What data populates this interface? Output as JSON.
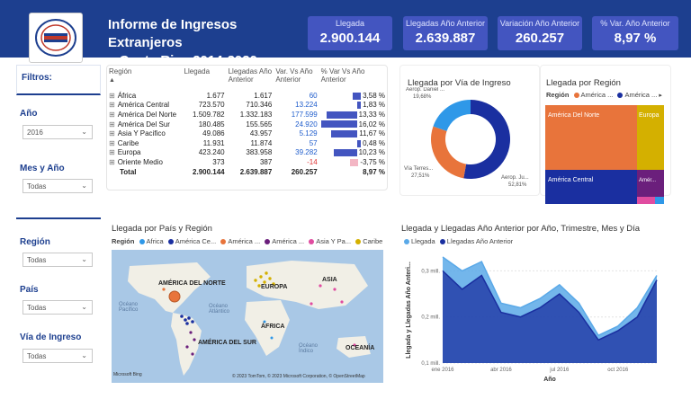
{
  "header": {
    "title_line1": "Informe de Ingresos Extranjeros",
    "title_line2": "a Costa Rica 2014-2020",
    "bg_color": "#1d3f8f"
  },
  "kpis": [
    {
      "label": "Llegada",
      "value": "2.900.144"
    },
    {
      "label": "Llegadas Año Anterior",
      "value": "2.639.887"
    },
    {
      "label": "Variación Año Anterior",
      "value": "260.257"
    },
    {
      "label": "% Var. Año Anterior",
      "value": "8,97 %"
    }
  ],
  "filters": {
    "title": "Filtros:",
    "year": {
      "label": "Año",
      "value": "2016"
    },
    "month": {
      "label": "Mes y Año",
      "value": "Todas"
    },
    "region": {
      "label": "Región",
      "value": "Todas"
    },
    "country": {
      "label": "País",
      "value": "Todas"
    },
    "route": {
      "label": "Vía de Ingreso",
      "value": "Todas"
    }
  },
  "table": {
    "headers": [
      "Región",
      "Llegada",
      "Llegadas Año Anterior",
      "Var. Vs Año Anterior",
      "% Var Vs Año Anterior"
    ],
    "rows": [
      {
        "region": "África",
        "llegada": "1.677",
        "anterior": "1.617",
        "var": "60",
        "pct": "3,58 %",
        "pct_value": 3.58
      },
      {
        "region": "América Central",
        "llegada": "723.570",
        "anterior": "710.346",
        "var": "13.224",
        "pct": "1,83 %",
        "pct_value": 1.83
      },
      {
        "region": "América Del Norte",
        "llegada": "1.509.782",
        "anterior": "1.332.183",
        "var": "177.599",
        "pct": "13,33 %",
        "pct_value": 13.33
      },
      {
        "region": "América Del Sur",
        "llegada": "180.485",
        "anterior": "155.565",
        "var": "24.920",
        "pct": "16,02 %",
        "pct_value": 16.02
      },
      {
        "region": "Asia Y Pacifico",
        "llegada": "49.086",
        "anterior": "43.957",
        "var": "5.129",
        "pct": "11,67 %",
        "pct_value": 11.67
      },
      {
        "region": "Caribe",
        "llegada": "11.931",
        "anterior": "11.874",
        "var": "57",
        "pct": "0,48 %",
        "pct_value": 0.48
      },
      {
        "region": "Europa",
        "llegada": "423.240",
        "anterior": "383.958",
        "var": "39.282",
        "pct": "10,23 %",
        "pct_value": 10.23
      },
      {
        "region": "Oriente Medio",
        "llegada": "373",
        "anterior": "387",
        "var": "-14",
        "pct": "-3,75 %",
        "pct_value": -3.75
      }
    ],
    "total": {
      "region": "Total",
      "llegada": "2.900.144",
      "anterior": "2.639.887",
      "var": "260.257",
      "pct": "8,97 %"
    }
  },
  "donut": {
    "title": "Llegada por Vía de Ingreso",
    "slices": [
      {
        "label": "Aerop. Ju...",
        "pct_label": "52,81%",
        "value": 52.81,
        "color": "#1a2fa0"
      },
      {
        "label": "Vía Terres...",
        "pct_label": "27,51%",
        "value": 27.51,
        "color": "#e8743b"
      },
      {
        "label": "Aerop. Daniel ...",
        "pct_label": "19,68%",
        "value": 19.68,
        "color": "#2f98e8"
      }
    ]
  },
  "treemap": {
    "title": "Llegada por Región",
    "legend_label": "Región",
    "legend_items": [
      {
        "name": "América ...",
        "color": "#e8743b"
      },
      {
        "name": "América ...",
        "color": "#1a2fa0"
      }
    ],
    "cells": [
      {
        "name": "América Del Norte",
        "color": "#e8743b"
      },
      {
        "name": "Europa",
        "color": "#d4b000"
      },
      {
        "name": "América Central",
        "color": "#1a2fa0"
      },
      {
        "name": "Amér...",
        "color": "#6b1f7c"
      }
    ]
  },
  "map": {
    "title": "Llegada por País y Región",
    "legend_label": "Región",
    "legend_items": [
      {
        "name": "Africa",
        "color": "#2f98e8"
      },
      {
        "name": "América Ce...",
        "color": "#1a2fa0"
      },
      {
        "name": "América ...",
        "color": "#e8743b"
      },
      {
        "name": "América ...",
        "color": "#6b1f7c"
      },
      {
        "name": "Asia Y Pa...",
        "color": "#e04ca0"
      },
      {
        "name": "Caribe",
        "color": "#d4b000"
      }
    ],
    "labels": {
      "na": "AMÉRICA DEL NORTE",
      "eu": "EUROPA",
      "asia": "ASIA",
      "af": "ÁFRICA",
      "sa": "AMÉRICA DEL SUR",
      "oc": "OCEANÍA",
      "pac": "Océano Pacífico",
      "atl": "Océano Atlántico",
      "ind": "Océano Índico"
    },
    "credit": "© 2023 TomTom, © 2023 Microsoft Corporation, © OpenStreetMap",
    "brand": "Microsoft Bing"
  },
  "line_chart": {
    "title": "Llegada y Llegadas Año Anterior por Año, Trimestre, Mes y Día",
    "xlabel": "Año",
    "ylabel": "Llegada y Llegadas Año Anteri...",
    "series_colors": [
      "#5aa9e8",
      "#1a2fa0"
    ]
  },
  "chart_data": {
    "type": "area",
    "title": "Llegada y Llegadas Año Anterior por Año, Trimestre, Mes y Día",
    "xlabel": "Año",
    "ylabel": "Llegada y Llegadas Año Anteri...",
    "x": [
      "ene 2016",
      "feb 2016",
      "mar 2016",
      "abr 2016",
      "may 2016",
      "jun 2016",
      "jul 2016",
      "ago 2016",
      "sep 2016",
      "oct 2016",
      "nov 2016",
      "dic 2016"
    ],
    "x_ticks": [
      "ene 2016",
      "abr 2016",
      "jul 2016",
      "oct 2016"
    ],
    "y_ticks": [
      "0,1 mill.",
      "0,2 mill.",
      "0,3 mill."
    ],
    "y_tick_values": [
      0.1,
      0.2,
      0.3
    ],
    "ylim": [
      0.1,
      0.33
    ],
    "series": [
      {
        "name": "Llegada",
        "values": [
          0.33,
          0.3,
          0.32,
          0.23,
          0.22,
          0.24,
          0.27,
          0.23,
          0.16,
          0.18,
          0.22,
          0.29
        ]
      },
      {
        "name": "Llegadas Año Anterior",
        "values": [
          0.3,
          0.26,
          0.29,
          0.21,
          0.2,
          0.22,
          0.25,
          0.21,
          0.15,
          0.17,
          0.2,
          0.28
        ]
      }
    ]
  }
}
